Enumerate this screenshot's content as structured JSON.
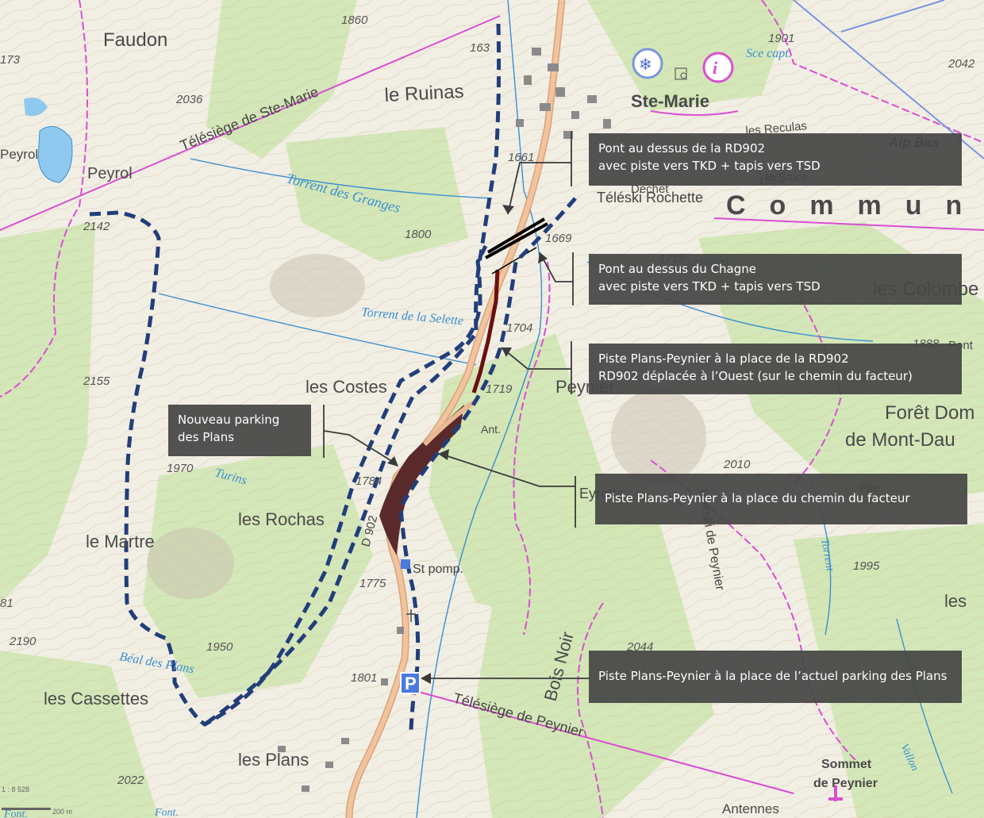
{
  "map": {
    "callouts": [
      {
        "lines": [
          "Pont au dessus de la RD902",
          "avec piste vers TKD + tapis vers TSD"
        ]
      },
      {
        "lines": [
          "Pont au dessus du Chagne",
          "avec piste vers TKD + tapis vers TSD"
        ]
      },
      {
        "lines": [
          "Piste Plans-Peynier à la place de la RD902",
          "RD902 déplacée à l’Ouest (sur le chemin du facteur)"
        ]
      },
      {
        "lines": [
          "Nouveau parking",
          "des Plans"
        ]
      },
      {
        "lines": [
          "Piste Plans-Peynier à la place du chemin du facteur"
        ]
      },
      {
        "lines": [
          "Piste Plans-Peynier à la place de l’actuel parking des Plans"
        ]
      }
    ],
    "place_names": [
      "Faudon",
      "le Ruinas",
      "Ste-Marie",
      "Peyrol",
      "Peyrol",
      "les Costes",
      "les Rochas",
      "le Martre",
      "les Cassettes",
      "les Plans",
      "Peynier",
      "les Colombe",
      "Forêt Dom",
      "de Mont-Dau",
      "Commune",
      "Alp Bas",
      "Sommet",
      "de Peynier",
      "Antennes",
      "les",
      "Bois Noir",
      "Dechet",
      "la Saice",
      "les Reculas",
      "Pont",
      "Ant.",
      "Eyrotte",
      "Plle",
      "C"
    ],
    "water_names": [
      "Torrent des Granges",
      "Torrent de la Selette",
      "Turins",
      "Béal des Plans",
      "Rav. du Bialet",
      "Torrent",
      "Vallon",
      "Sce capt.",
      "Font.",
      "Font."
    ],
    "lift_labels": [
      "Télésiège de Ste-Marie",
      "Téléski Rochette",
      "Téléski de Peynier",
      "Télésiège de Peynier"
    ],
    "road_labels": [
      "D 902",
      "St pomp."
    ],
    "elevations": [
      "1860",
      "173",
      "2036",
      "163",
      "1901",
      "2042",
      "1661",
      "1669",
      "1719",
      "1704",
      "1719",
      "1784",
      "1775",
      "1801",
      "2142",
      "2155",
      "1970",
      "2190",
      "2022",
      "2010",
      "1995",
      "2044",
      "1888",
      "1800",
      "1950",
      "1950",
      "81"
    ],
    "scale": {
      "ratio": "1 : 8 528",
      "distance": "200 m"
    },
    "colors": {
      "piste_route": "#6b0f0f",
      "new_parking": "#5a2a2a",
      "dashed_boundary": "#223e7a",
      "road": "#e8a070",
      "callout_bg": "#464646",
      "commune_boundary": "#d94fd1",
      "ski_lift": "#d94fd1",
      "forest": "#cfe6b2",
      "water": "#3a8fd0"
    },
    "icons": [
      "snowflake-badge-icon",
      "info-badge-icon",
      "parking-icon",
      "ski-lift-station-icon",
      "church-icon"
    ]
  }
}
